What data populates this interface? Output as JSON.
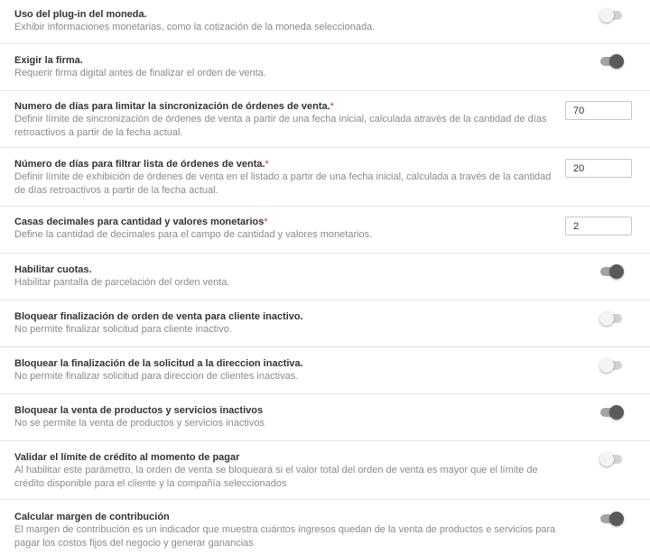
{
  "settings": [
    {
      "title": "Uso del plug-in del moneda.",
      "required": false,
      "description": "Exhibir informaciones monetarias, como la cotización de la moneda seleccionada.",
      "control": "toggle",
      "enabled": false
    },
    {
      "title": "Exigir la firma.",
      "required": false,
      "description": "Requerir firma digital antes de finalizar el orden de venta.",
      "control": "toggle",
      "enabled": true
    },
    {
      "title": "Numero de días para limitar la sincronización de órdenes de venta.",
      "required": true,
      "description": "Definir límite de sincronización de órdenes de venta a partir de una fecha inicial, calculada através de la cantidad de días retroactivos a partir de la fecha actual.",
      "control": "number",
      "value": "70"
    },
    {
      "title": "Número de días para filtrar lista de órdenes de venta.",
      "required": true,
      "description": "Definir límite de exhibición de órdenes de venta en el listado a partir de una fecha inicial, calculada a través de la cantidad de días retroactivos a partir de la fecha actual.",
      "control": "number",
      "value": "20"
    },
    {
      "title": "Casas decimales para cantidad y valores monetarios",
      "required": true,
      "description": "Define la cantidad de decimales para el campo de cantidad y valores monetarios.",
      "control": "number",
      "value": "2"
    },
    {
      "title": "Habilitar cuotas.",
      "required": false,
      "description": "Habilitar pantalla de parcelación del orden venta.",
      "control": "toggle",
      "enabled": true
    },
    {
      "title": "Bloquear finalización de orden de venta para cliente inactivo.",
      "required": false,
      "description": "No permite finalizar solicitud para cliente inactivo.",
      "control": "toggle",
      "enabled": false
    },
    {
      "title": "Bloquear la finalización de la solicitud a la direccion inactiva.",
      "required": false,
      "description": "No permite finalizar solicitud para direccion de clientes inactivas.",
      "control": "toggle",
      "enabled": false
    },
    {
      "title": "Bloquear la venta de productos y servicios inactivos",
      "required": false,
      "description": "No se permite la venta de productos y servicios inactivos",
      "control": "toggle",
      "enabled": true
    },
    {
      "title": "Validar el límite de crédito al momento de pagar",
      "required": false,
      "description": "Al habilitar este parámetro, la orden de venta se bloqueará si el valor total del orden de venta es mayor que el límite de crédito disponible para el cliente y la compañía seleccionados",
      "control": "toggle",
      "enabled": false
    },
    {
      "title": "Calcular margen de contribución",
      "required": false,
      "description": "El margen de contribución es un indicador que muestra cuántos ingresos quedan de la venta de productos e servicios para pagar los costos fijos del negocio y generar ganancias",
      "control": "toggle",
      "enabled": true
    }
  ],
  "required_marker": "*"
}
